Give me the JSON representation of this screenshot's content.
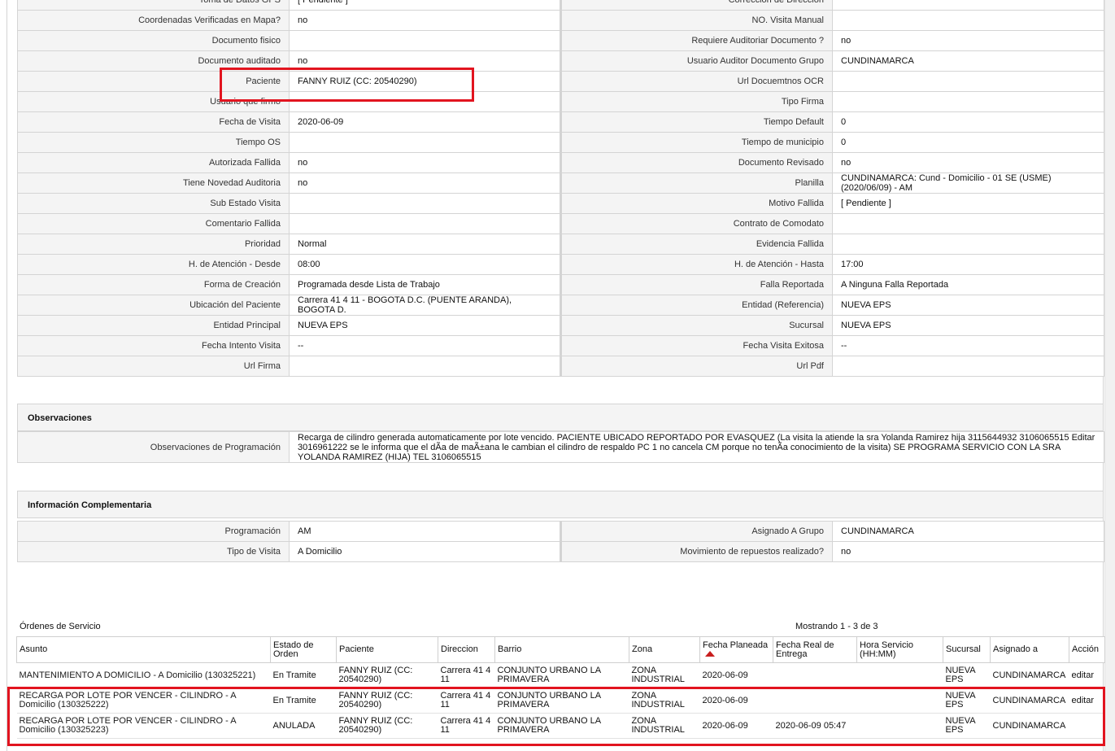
{
  "fields": [
    {
      "l1": "Toma de Datos GPS",
      "v1": "[ Pendiente ]",
      "l2": "Correccion de Direccion",
      "v2": ""
    },
    {
      "l1": "Coordenadas Verificadas en Mapa?",
      "v1": "no",
      "l2": "NO. Visita Manual",
      "v2": ""
    },
    {
      "l1": "Documento fisico",
      "v1": "",
      "l2": "Requiere Auditoriar Documento ?",
      "v2": "no"
    },
    {
      "l1": "Documento auditado",
      "v1": "no",
      "l2": "Usuario Auditor Documento Grupo",
      "v2": "CUNDINAMARCA"
    },
    {
      "l1": "Paciente",
      "v1": "FANNY RUIZ (CC: 20540290)",
      "l2": "Url Docuemtnos OCR",
      "v2": ""
    },
    {
      "l1": "Usuario que firmo",
      "v1": "",
      "l2": "Tipo Firma",
      "v2": ""
    },
    {
      "l1": "Fecha de Visita",
      "v1": "2020-06-09",
      "l2": "Tiempo Default",
      "v2": "0"
    },
    {
      "l1": "Tiempo OS",
      "v1": "",
      "l2": "Tiempo de municipio",
      "v2": "0"
    },
    {
      "l1": "Autorizada Fallida",
      "v1": "no",
      "l2": "Documento Revisado",
      "v2": "no"
    },
    {
      "l1": "Tiene Novedad Auditoria",
      "v1": "no",
      "l2": "Planilla",
      "v2": "CUNDINAMARCA: Cund - Domicilio - 01 SE (USME) (2020/06/09) - AM"
    },
    {
      "l1": "Sub Estado Visita",
      "v1": "",
      "l2": "Motivo Fallida",
      "v2": "[ Pendiente ]"
    },
    {
      "l1": "Comentario Fallida",
      "v1": "",
      "l2": "Contrato de Comodato",
      "v2": ""
    },
    {
      "l1": "Prioridad",
      "v1": "Normal",
      "l2": "Evidencia Fallida",
      "v2": ""
    },
    {
      "l1": "H. de Atención - Desde",
      "v1": "08:00",
      "l2": "H. de Atención - Hasta",
      "v2": "17:00"
    },
    {
      "l1": "Forma de Creación",
      "v1": "Programada desde Lista de Trabajo",
      "l2": "Falla Reportada",
      "v2": "A Ninguna Falla Reportada"
    },
    {
      "l1": "Ubicación del Paciente",
      "v1": "Carrera 41 4 11 - BOGOTA D.C. (PUENTE ARANDA), BOGOTA D.",
      "l2": "Entidad (Referencia)",
      "v2": "NUEVA EPS"
    },
    {
      "l1": "Entidad Principal",
      "v1": "NUEVA EPS",
      "l2": "Sucursal",
      "v2": "NUEVA EPS"
    },
    {
      "l1": "Fecha Intento Visita",
      "v1": "--",
      "l2": "Fecha Visita Exitosa",
      "v2": "--"
    },
    {
      "l1": "Url Firma",
      "v1": "",
      "l2": "Url Pdf",
      "v2": ""
    }
  ],
  "observaciones": {
    "title": "Observaciones",
    "label": "Observaciones de Programación",
    "value": "Recarga de cilindro generada automaticamente por lote vencido. PACIENTE UBICADO REPORTADO POR EVASQUEZ (La visita la atiende la sra Yolanda Ramirez hija 3115644932 3106065515 Editar 3016961222 se le informa que el dÃa de maÃ±ana le cambian el cilindro de respaldo PC 1 no cancela CM porque no tenÃa conocimiento de la visita) SE PROGRAMA SERVICIO CON LA SRA YOLANDA RAMIREZ (HIJA) TEL 3106065515"
  },
  "complementaria": {
    "title": "Información Complementaria",
    "rows": [
      {
        "l1": "Programación",
        "v1": "AM",
        "l2": "Asignado A Grupo",
        "v2": "CUNDINAMARCA"
      },
      {
        "l1": "Tipo de Visita",
        "v1": "A Domicilio",
        "l2": "Movimiento de repuestos realizado?",
        "v2": "no"
      }
    ]
  },
  "orders": {
    "title": "Órdenes de Servicio",
    "count": "Mostrando 1 - 3 de 3",
    "columns": [
      "Asunto",
      "Estado de Orden",
      "Paciente",
      "Direccion",
      "Barrio",
      "Zona",
      "Fecha Planeada",
      "Fecha Real de Entrega",
      "Hora Servicio (HH:MM)",
      "Sucursal",
      "Asignado a",
      "Acción"
    ],
    "rows": [
      [
        "MANTENIMIENTO A DOMICILIO - A Domicilio (130325221)",
        "En Tramite",
        "FANNY RUIZ (CC: 20540290)",
        "Carrera 41 4 11",
        "CONJUNTO URBANO LA PRIMAVERA",
        "ZONA INDUSTRIAL",
        "2020-06-09",
        "",
        "",
        "NUEVA EPS",
        "CUNDINAMARCA",
        "editar"
      ],
      [
        "RECARGA POR LOTE POR VENCER - CILINDRO - A Domicilio (130325222)",
        "En Tramite",
        "FANNY RUIZ (CC: 20540290)",
        "Carrera 41 4 11",
        "CONJUNTO URBANO LA PRIMAVERA",
        "ZONA INDUSTRIAL",
        "2020-06-09",
        "",
        "",
        "NUEVA EPS",
        "CUNDINAMARCA",
        "editar"
      ],
      [
        "RECARGA POR LOTE POR VENCER - CILINDRO - A Domicilio (130325223)",
        "ANULADA",
        "FANNY RUIZ (CC: 20540290)",
        "Carrera 41 4 11",
        "CONJUNTO URBANO LA PRIMAVERA",
        "ZONA INDUSTRIAL",
        "2020-06-09",
        "2020-06-09 05:47",
        "",
        "NUEVA EPS",
        "CUNDINAMARCA",
        ""
      ]
    ]
  },
  "colors": {
    "highlight": "#e2141f",
    "label_bg": "#f4f4f4",
    "border": "#d4d4d4"
  }
}
